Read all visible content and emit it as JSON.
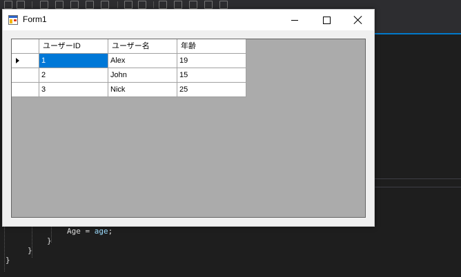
{
  "window": {
    "title": "Form1"
  },
  "grid": {
    "columns": [
      "ユーザーID",
      "ユーザー名",
      "年齢"
    ],
    "rows": [
      {
        "id": "1",
        "name": "Alex",
        "age": "19"
      },
      {
        "id": "2",
        "name": "John",
        "age": "15"
      },
      {
        "id": "3",
        "name": "Nick",
        "age": "25"
      }
    ],
    "current_row": 1,
    "selected_cell": "ユーザーID"
  },
  "code": {
    "line1_prefix": "Age = ",
    "line1_ident": "age",
    "line1_suffix": ";",
    "line2": "}",
    "line3": "}",
    "line4": "}"
  },
  "colors": {
    "selection": "#0078d7",
    "grid_background": "#ababab",
    "ide_background": "#1e1e1e"
  }
}
